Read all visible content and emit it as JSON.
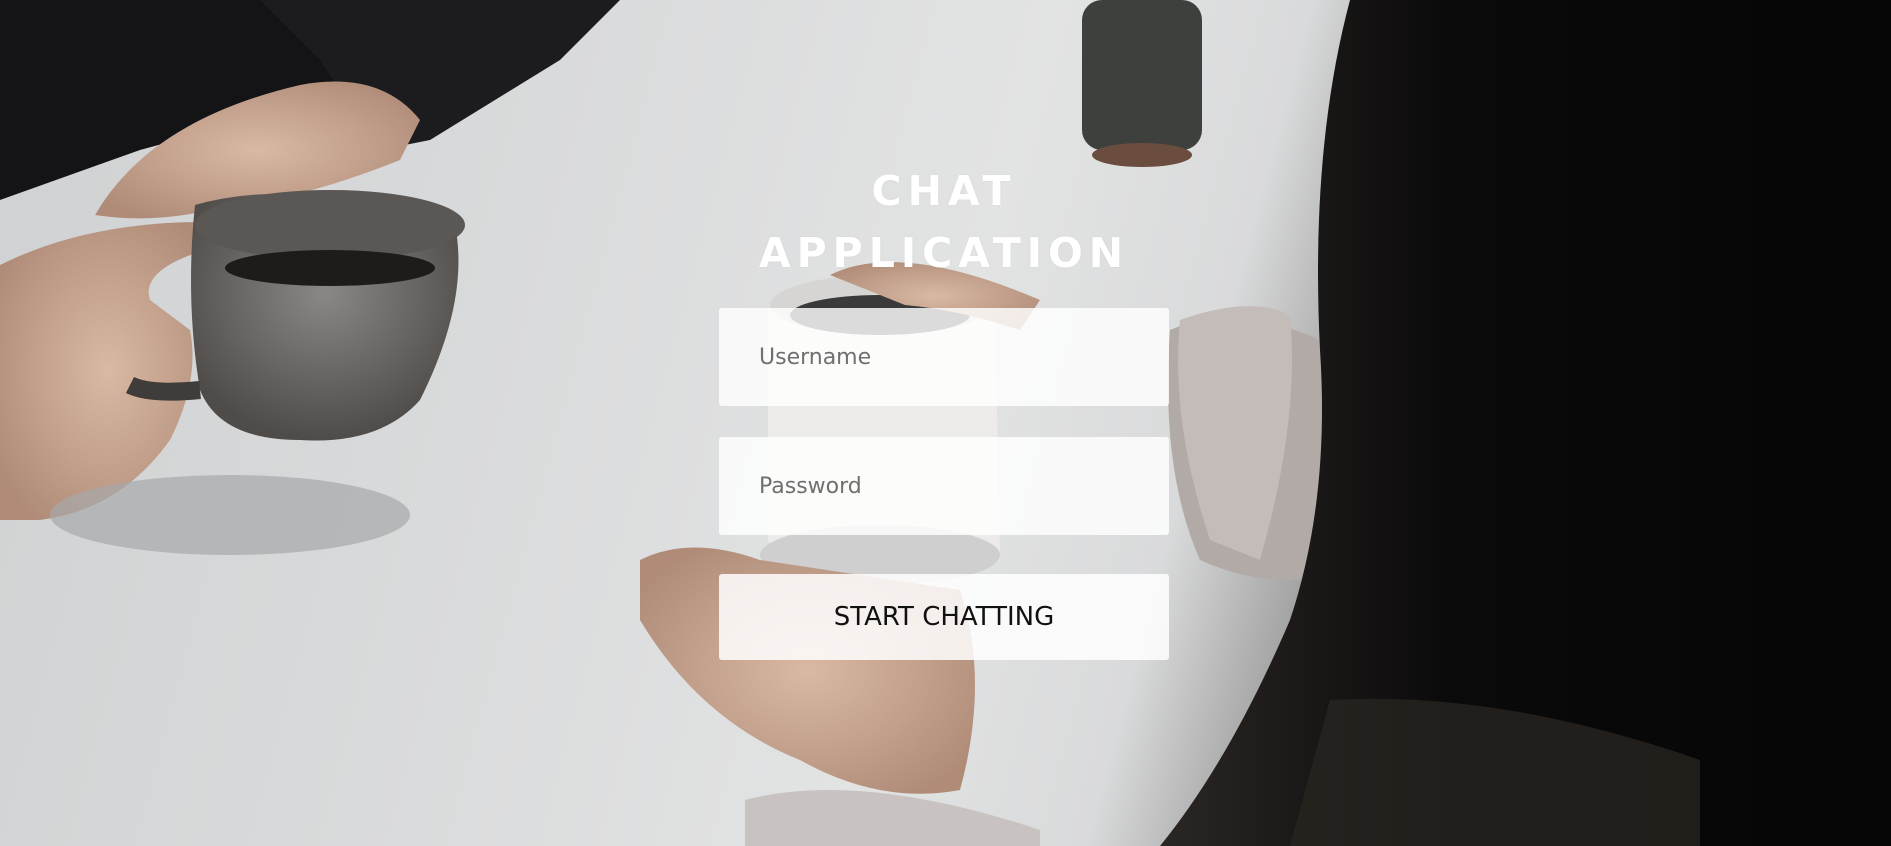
{
  "app": {
    "title": "CHAT APPLICATION"
  },
  "form": {
    "username_placeholder": "Username",
    "password_placeholder": "Password",
    "submit_label": "START CHATTING"
  },
  "colors": {
    "title_text": "#ffffff",
    "field_background": "#ffffff",
    "button_text": "#111111"
  }
}
